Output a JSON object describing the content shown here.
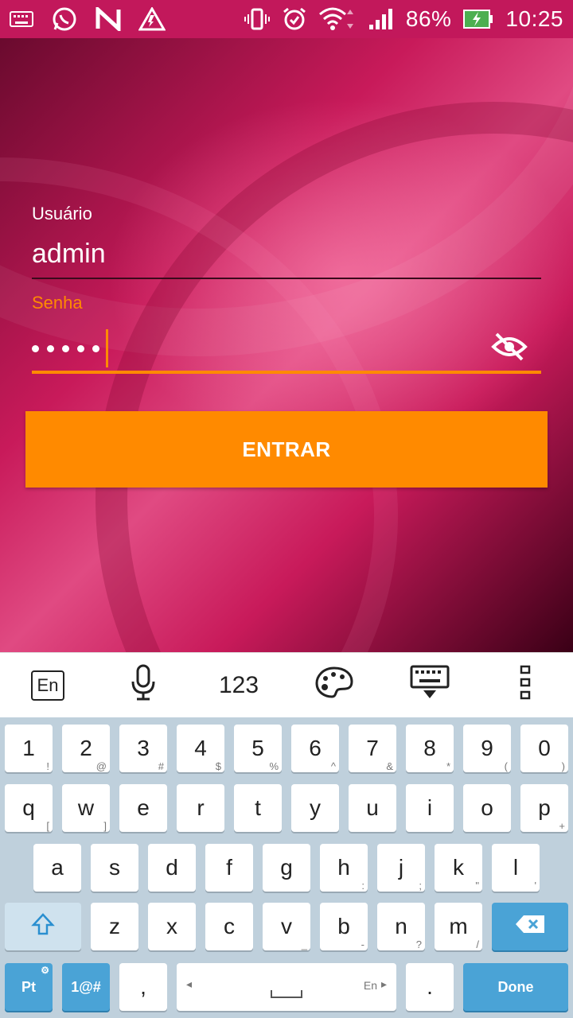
{
  "status_bar": {
    "battery_percent": "86%",
    "time": "10:25",
    "icons": [
      "keyboard-icon",
      "whatsapp-icon",
      "n-app-icon",
      "warning-icon",
      "vibrate-icon",
      "alarm-icon",
      "wifi-icon",
      "signal-icon",
      "battery-charging-icon"
    ]
  },
  "login": {
    "user_label": "Usuário",
    "user_value": "admin",
    "password_label": "Senha",
    "password_length": 5,
    "submit_label": "ENTRAR"
  },
  "keyboard": {
    "toolbar": {
      "lang_label": "En",
      "numbers_label": "123"
    },
    "row_digits": [
      {
        "k": "1",
        "s": "!"
      },
      {
        "k": "2",
        "s": "@"
      },
      {
        "k": "3",
        "s": "#"
      },
      {
        "k": "4",
        "s": "$"
      },
      {
        "k": "5",
        "s": "%"
      },
      {
        "k": "6",
        "s": "^"
      },
      {
        "k": "7",
        "s": "&"
      },
      {
        "k": "8",
        "s": "*"
      },
      {
        "k": "9",
        "s": "("
      },
      {
        "k": "0",
        "s": ")"
      }
    ],
    "row_q": [
      {
        "k": "q",
        "s": "["
      },
      {
        "k": "w",
        "s": "]"
      },
      {
        "k": "e",
        "s": ""
      },
      {
        "k": "r",
        "s": ""
      },
      {
        "k": "t",
        "s": ""
      },
      {
        "k": "y",
        "s": ""
      },
      {
        "k": "u",
        "s": ""
      },
      {
        "k": "i",
        "s": ""
      },
      {
        "k": "o",
        "s": ""
      },
      {
        "k": "p",
        "s": "+"
      }
    ],
    "row_a": [
      {
        "k": "a",
        "s": ""
      },
      {
        "k": "s",
        "s": ""
      },
      {
        "k": "d",
        "s": ""
      },
      {
        "k": "f",
        "s": ""
      },
      {
        "k": "g",
        "s": ""
      },
      {
        "k": "h",
        "s": ":"
      },
      {
        "k": "j",
        "s": ";"
      },
      {
        "k": "k",
        "s": "\""
      },
      {
        "k": "l",
        "s": "'"
      }
    ],
    "row_z": [
      {
        "k": "z",
        "s": ""
      },
      {
        "k": "x",
        "s": ""
      },
      {
        "k": "c",
        "s": ""
      },
      {
        "k": "v",
        "s": "_"
      },
      {
        "k": "b",
        "s": "-"
      },
      {
        "k": "n",
        "s": "?"
      },
      {
        "k": "m",
        "s": "/"
      }
    ],
    "bottom": {
      "lang_key": "Pt",
      "symbols_key": "1@#",
      "comma_key": ",",
      "space_hint": "En",
      "period_key": ".",
      "done_key": "Done"
    }
  },
  "colors": {
    "status_bar": "#c2185b",
    "accent": "#ff8a00",
    "keyboard_bg": "#bfd0dc",
    "key_blue": "#4aa3d6"
  }
}
